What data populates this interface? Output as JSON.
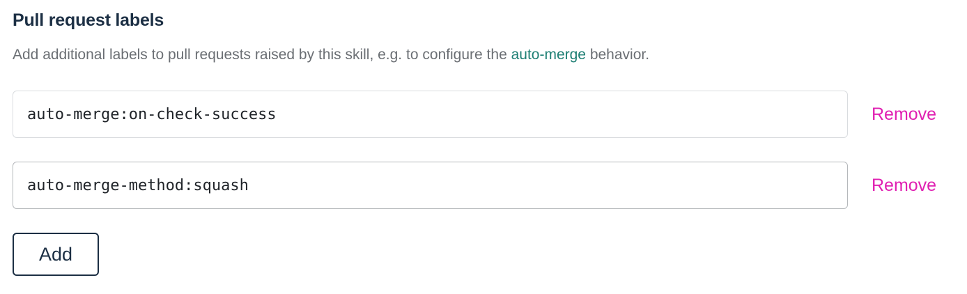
{
  "section": {
    "title": "Pull request labels",
    "description_before": "Add additional labels to pull requests raised by this skill, e.g. to configure the ",
    "description_link": "auto-merge",
    "description_after": " behavior."
  },
  "labels": [
    {
      "value": "auto-merge:on-check-success",
      "remove_label": "Remove"
    },
    {
      "value": "auto-merge-method:squash",
      "remove_label": "Remove"
    }
  ],
  "add_button_label": "Add",
  "colors": {
    "title": "#1c2f44",
    "description": "#6b6f74",
    "link": "#1e7f74",
    "remove": "#e020b2",
    "button_border": "#1c2f44"
  }
}
